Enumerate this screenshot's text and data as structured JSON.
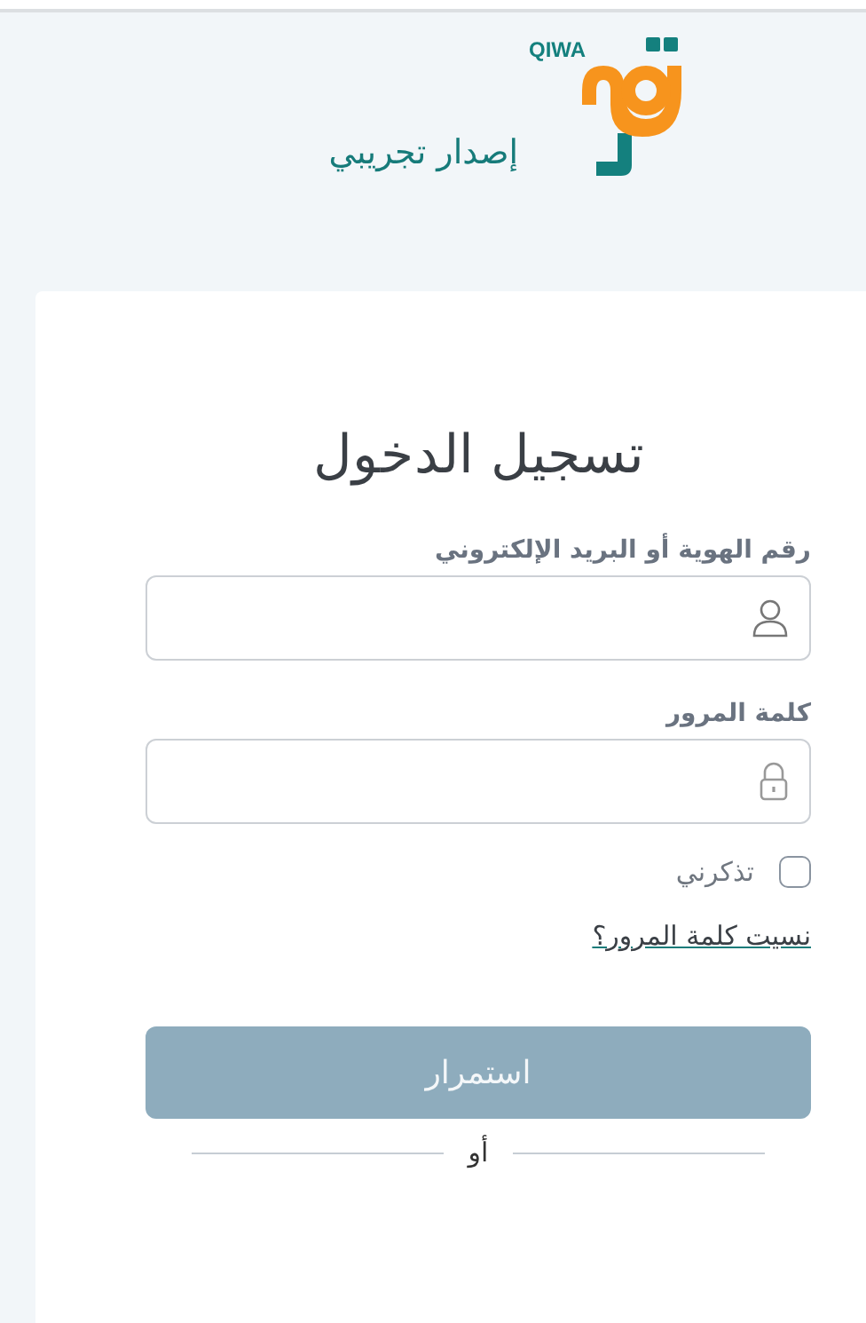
{
  "logo": {
    "wordmark": "QIWA",
    "caption": "إصدار تجريبي"
  },
  "login": {
    "title": "تسجيل الدخول",
    "fields": [
      {
        "label": "رقم الهوية أو البريد الإلكتروني",
        "kind": "user"
      },
      {
        "label": "كلمة المرور",
        "kind": "lock"
      }
    ],
    "remember": {
      "label": "تذكرني",
      "checked": false
    },
    "forgot_link": "نسيت كلمة المرور؟",
    "submit": {
      "label": "استمرار",
      "disabled": true
    },
    "divider": "أو"
  }
}
